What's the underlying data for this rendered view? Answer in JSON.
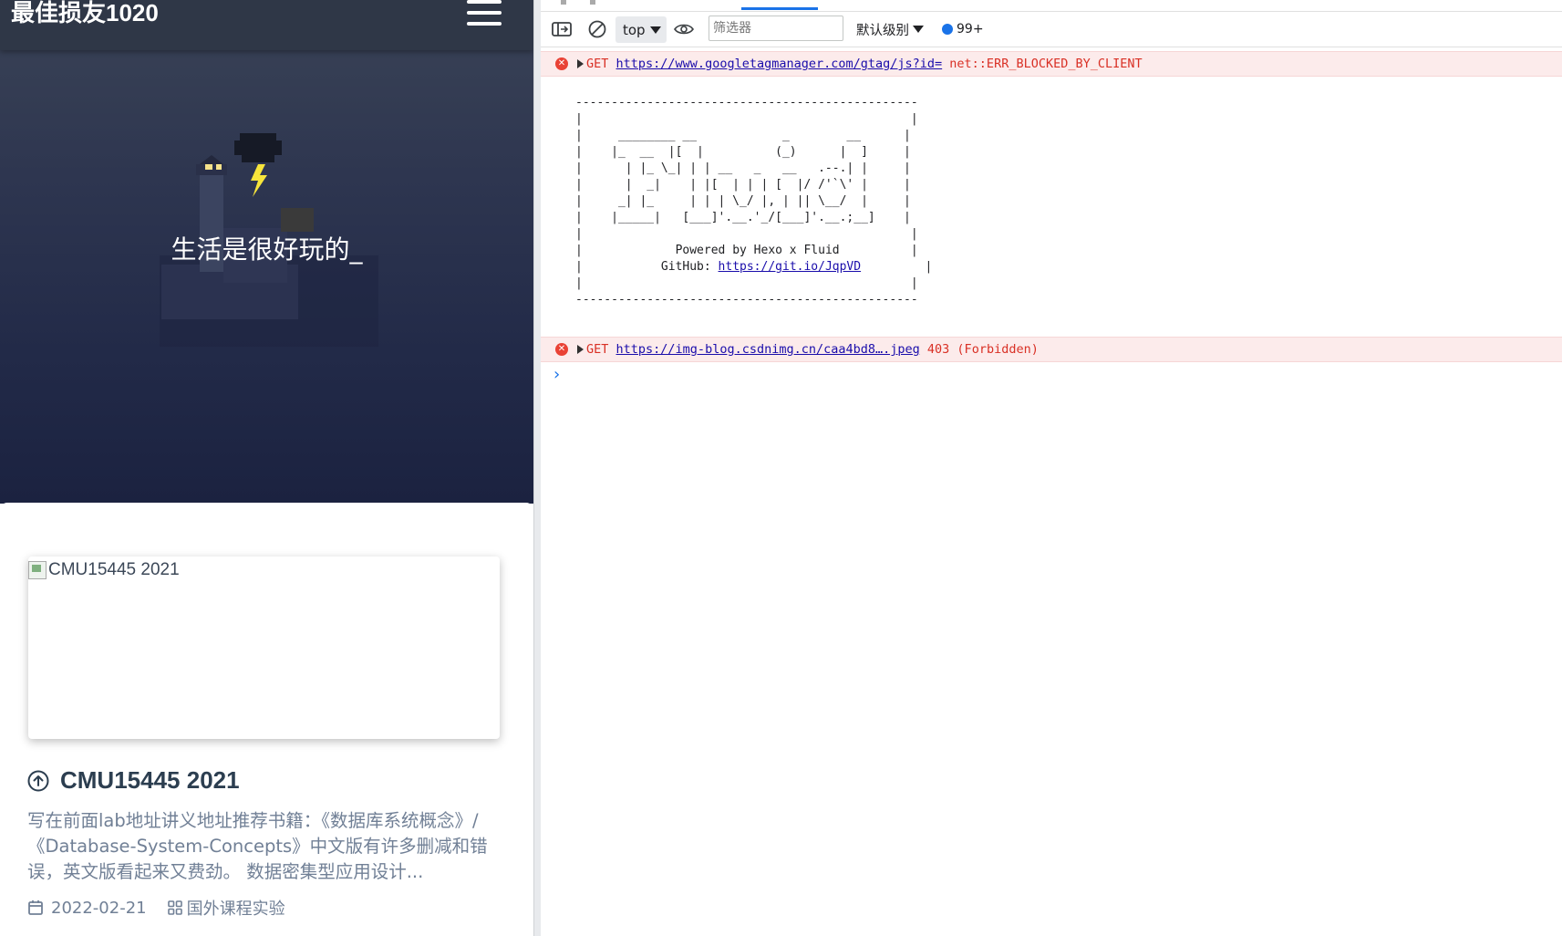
{
  "blog": {
    "brand": "最佳损友1020",
    "slogan": "生活是很好玩的_",
    "post": {
      "image_alt": "CMU15445 2021",
      "title": "CMU15445 2021",
      "excerpt": "写在前面lab地址讲义地址推荐书籍：《数据库系统概念》/《Database-System-Concepts》中文版有许多删减和错误，英文版看起来又费劲。 数据密集型应用设计...",
      "date": "2022-02-21",
      "category": "国外课程实验"
    }
  },
  "devtools": {
    "toolbar": {
      "context": "top",
      "filter_placeholder": "筛选器",
      "level": "默认级别",
      "issues_count": "99+"
    },
    "console": {
      "error1": {
        "method": "GET",
        "url": "https://www.googletagmanager.com/gtag/js?id=",
        "status": "net::ERR_BLOCKED_BY_CLIENT"
      },
      "ascii_banner": {
        "lines": [
          "------------------------------------------------",
          "|                                              |",
          "|     ________ __            _        __      |",
          "|    |_  __  |[  |          (_)      |  ]     |",
          "|      | |_ \\_| | | __   _   __   .--.| |     |",
          "|      |  _|    | |[  | | | [  |/ /'`\\' |     |",
          "|     _| |_     | | | \\_/ |, | || \\__/  |     |",
          "|    |_____|   [___]'.__.'_/[___]'.__.;__]    |",
          "|                                              |"
        ],
        "powered_by": "Powered by Hexo x Fluid",
        "github_label": "GitHub: ",
        "github_url": "https://git.io/JqpVD",
        "bottom_lines": [
          "|                                              |",
          "------------------------------------------------"
        ]
      },
      "error2": {
        "method": "GET",
        "url": "https://img-blog.csdnimg.cn/caa4bd8….jpeg",
        "status": "403 (Forbidden)"
      },
      "prompt_symbol": "›"
    }
  },
  "colors": {
    "navbar": "#2f3747",
    "error_bg": "#fcebeb",
    "error_text": "#d93025",
    "accent_blue": "#1a73e8",
    "text_muted": "#718096",
    "title_dark": "#2c3e50"
  }
}
